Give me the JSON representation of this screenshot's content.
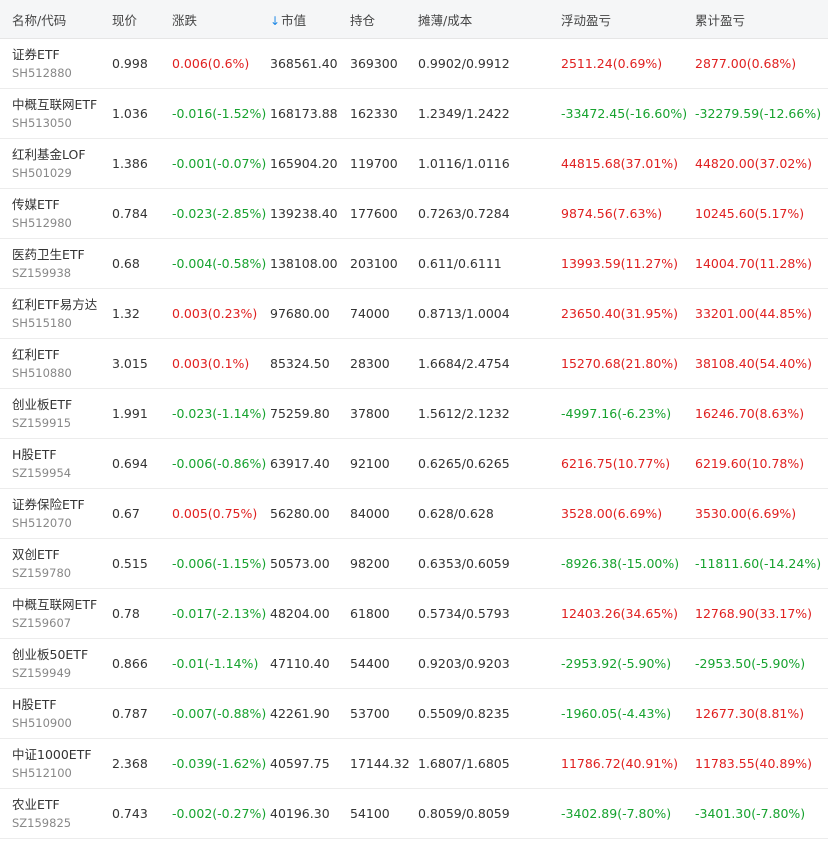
{
  "header": {
    "name": "名称/代码",
    "price": "现价",
    "change": "涨跌",
    "sort_icon": "↓",
    "market_value": "市值",
    "position": "持仓",
    "cost": "摊薄/成本",
    "floating_pl": "浮动盈亏",
    "total_pl": "累计盈亏"
  },
  "colors": {
    "up": "#e02020",
    "down": "#16a22e",
    "sort_accent": "#1e88e5"
  },
  "rows": [
    {
      "name": "证券ETF",
      "code": "SH512880",
      "price": "0.998",
      "change": "0.006(0.6%)",
      "change_dir": "up",
      "market_value": "368561.40",
      "position": "369300",
      "cost": "0.9902/0.9912",
      "floating_pl": "2511.24(0.69%)",
      "floating_dir": "up",
      "total_pl": "2877.00(0.68%)",
      "total_dir": "up"
    },
    {
      "name": "中概互联网ETF",
      "code": "SH513050",
      "price": "1.036",
      "change": "-0.016(-1.52%)",
      "change_dir": "down",
      "market_value": "168173.88",
      "position": "162330",
      "cost": "1.2349/1.2422",
      "floating_pl": "-33472.45(-16.60%)",
      "floating_dir": "down",
      "total_pl": "-32279.59(-12.66%)",
      "total_dir": "down"
    },
    {
      "name": "红利基金LOF",
      "code": "SH501029",
      "price": "1.386",
      "change": "-0.001(-0.07%)",
      "change_dir": "down",
      "market_value": "165904.20",
      "position": "119700",
      "cost": "1.0116/1.0116",
      "floating_pl": "44815.68(37.01%)",
      "floating_dir": "up",
      "total_pl": "44820.00(37.02%)",
      "total_dir": "up"
    },
    {
      "name": "传媒ETF",
      "code": "SH512980",
      "price": "0.784",
      "change": "-0.023(-2.85%)",
      "change_dir": "down",
      "market_value": "139238.40",
      "position": "177600",
      "cost": "0.7263/0.7284",
      "floating_pl": "9874.56(7.63%)",
      "floating_dir": "up",
      "total_pl": "10245.60(5.17%)",
      "total_dir": "up"
    },
    {
      "name": "医药卫生ETF",
      "code": "SZ159938",
      "price": "0.68",
      "change": "-0.004(-0.58%)",
      "change_dir": "down",
      "market_value": "138108.00",
      "position": "203100",
      "cost": "0.611/0.6111",
      "floating_pl": "13993.59(11.27%)",
      "floating_dir": "up",
      "total_pl": "14004.70(11.28%)",
      "total_dir": "up"
    },
    {
      "name": "红利ETF易方达",
      "code": "SH515180",
      "price": "1.32",
      "change": "0.003(0.23%)",
      "change_dir": "up",
      "market_value": "97680.00",
      "position": "74000",
      "cost": "0.8713/1.0004",
      "floating_pl": "23650.40(31.95%)",
      "floating_dir": "up",
      "total_pl": "33201.00(44.85%)",
      "total_dir": "up"
    },
    {
      "name": "红利ETF",
      "code": "SH510880",
      "price": "3.015",
      "change": "0.003(0.1%)",
      "change_dir": "up",
      "market_value": "85324.50",
      "position": "28300",
      "cost": "1.6684/2.4754",
      "floating_pl": "15270.68(21.80%)",
      "floating_dir": "up",
      "total_pl": "38108.40(54.40%)",
      "total_dir": "up"
    },
    {
      "name": "创业板ETF",
      "code": "SZ159915",
      "price": "1.991",
      "change": "-0.023(-1.14%)",
      "change_dir": "down",
      "market_value": "75259.80",
      "position": "37800",
      "cost": "1.5612/2.1232",
      "floating_pl": "-4997.16(-6.23%)",
      "floating_dir": "down",
      "total_pl": "16246.70(8.63%)",
      "total_dir": "up"
    },
    {
      "name": "H股ETF",
      "code": "SZ159954",
      "price": "0.694",
      "change": "-0.006(-0.86%)",
      "change_dir": "down",
      "market_value": "63917.40",
      "position": "92100",
      "cost": "0.6265/0.6265",
      "floating_pl": "6216.75(10.77%)",
      "floating_dir": "up",
      "total_pl": "6219.60(10.78%)",
      "total_dir": "up"
    },
    {
      "name": "证券保险ETF",
      "code": "SH512070",
      "price": "0.67",
      "change": "0.005(0.75%)",
      "change_dir": "up",
      "market_value": "56280.00",
      "position": "84000",
      "cost": "0.628/0.628",
      "floating_pl": "3528.00(6.69%)",
      "floating_dir": "up",
      "total_pl": "3530.00(6.69%)",
      "total_dir": "up"
    },
    {
      "name": "双创ETF",
      "code": "SZ159780",
      "price": "0.515",
      "change": "-0.006(-1.15%)",
      "change_dir": "down",
      "market_value": "50573.00",
      "position": "98200",
      "cost": "0.6353/0.6059",
      "floating_pl": "-8926.38(-15.00%)",
      "floating_dir": "down",
      "total_pl": "-11811.60(-14.24%)",
      "total_dir": "down"
    },
    {
      "name": "中概互联网ETF",
      "code": "SZ159607",
      "price": "0.78",
      "change": "-0.017(-2.13%)",
      "change_dir": "down",
      "market_value": "48204.00",
      "position": "61800",
      "cost": "0.5734/0.5793",
      "floating_pl": "12403.26(34.65%)",
      "floating_dir": "up",
      "total_pl": "12768.90(33.17%)",
      "total_dir": "up"
    },
    {
      "name": "创业板50ETF",
      "code": "SZ159949",
      "price": "0.866",
      "change": "-0.01(-1.14%)",
      "change_dir": "down",
      "market_value": "47110.40",
      "position": "54400",
      "cost": "0.9203/0.9203",
      "floating_pl": "-2953.92(-5.90%)",
      "floating_dir": "down",
      "total_pl": "-2953.50(-5.90%)",
      "total_dir": "down"
    },
    {
      "name": "H股ETF",
      "code": "SH510900",
      "price": "0.787",
      "change": "-0.007(-0.88%)",
      "change_dir": "down",
      "market_value": "42261.90",
      "position": "53700",
      "cost": "0.5509/0.8235",
      "floating_pl": "-1960.05(-4.43%)",
      "floating_dir": "down",
      "total_pl": "12677.30(8.81%)",
      "total_dir": "up"
    },
    {
      "name": "中证1000ETF",
      "code": "SH512100",
      "price": "2.368",
      "change": "-0.039(-1.62%)",
      "change_dir": "down",
      "market_value": "40597.75",
      "position": "17144.32",
      "cost": "1.6807/1.6805",
      "floating_pl": "11786.72(40.91%)",
      "floating_dir": "up",
      "total_pl": "11783.55(40.89%)",
      "total_dir": "up"
    },
    {
      "name": "农业ETF",
      "code": "SZ159825",
      "price": "0.743",
      "change": "-0.002(-0.27%)",
      "change_dir": "down",
      "market_value": "40196.30",
      "position": "54100",
      "cost": "0.8059/0.8059",
      "floating_pl": "-3402.89(-7.80%)",
      "floating_dir": "down",
      "total_pl": "-3401.30(-7.80%)",
      "total_dir": "down"
    }
  ]
}
